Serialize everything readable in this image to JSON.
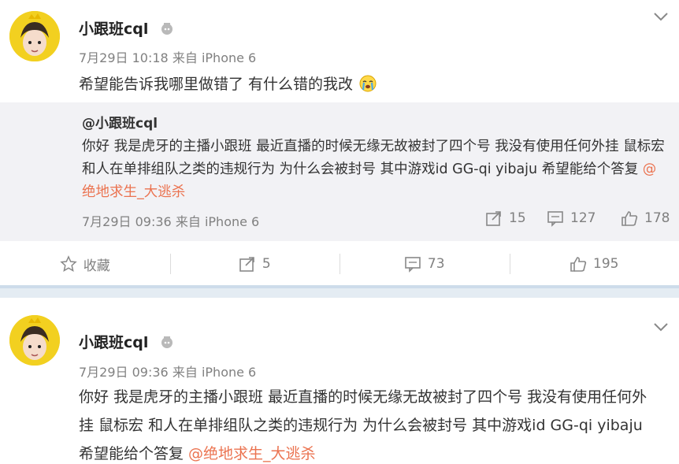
{
  "post1": {
    "username": "小跟班cql",
    "time": "7月29日 10:18",
    "source_prefix": "来自",
    "source": "iPhone 6",
    "text": "希望能告诉我哪里做错了 有什么错的我改",
    "emoji": "crying-face",
    "repost": {
      "username": "@小跟班cql",
      "text": "你好 我是虎牙的主播小跟班 最近直播的时候无缘无故被封了四个号 我没有使用任何外挂 鼠标宏 和人在单排组队之类的违规行为 为什么会被封号 其中游戏id GG-qi yibaju 希望能给个答复 ",
      "mention": "@绝地求生_大逃杀",
      "time": "7月29日 09:36",
      "source_prefix": "来自",
      "source": "iPhone 6",
      "reposts": "15",
      "comments": "127",
      "likes": "178"
    },
    "actions": {
      "favorite_label": "收藏",
      "repost_count": "5",
      "comment_count": "73",
      "like_count": "195"
    }
  },
  "post2": {
    "username": "小跟班cql",
    "time": "7月29日 09:36",
    "source_prefix": "来自",
    "source": "iPhone 6",
    "text": "你好 我是虎牙的主播小跟班 最近直播的时候无缘无故被封了四个号 我没有使用任何外挂 鼠标宏 和人在单排组队之类的违规行为 为什么会被封号 其中游戏id GG-qi yibaju 希望能给个答复 ",
    "mention": "@绝地求生_大逃杀"
  },
  "colors": {
    "mention": "#eb7350",
    "meta": "#808080",
    "separator": "#e4ecf3",
    "repost_bg": "#f2f2f5"
  }
}
